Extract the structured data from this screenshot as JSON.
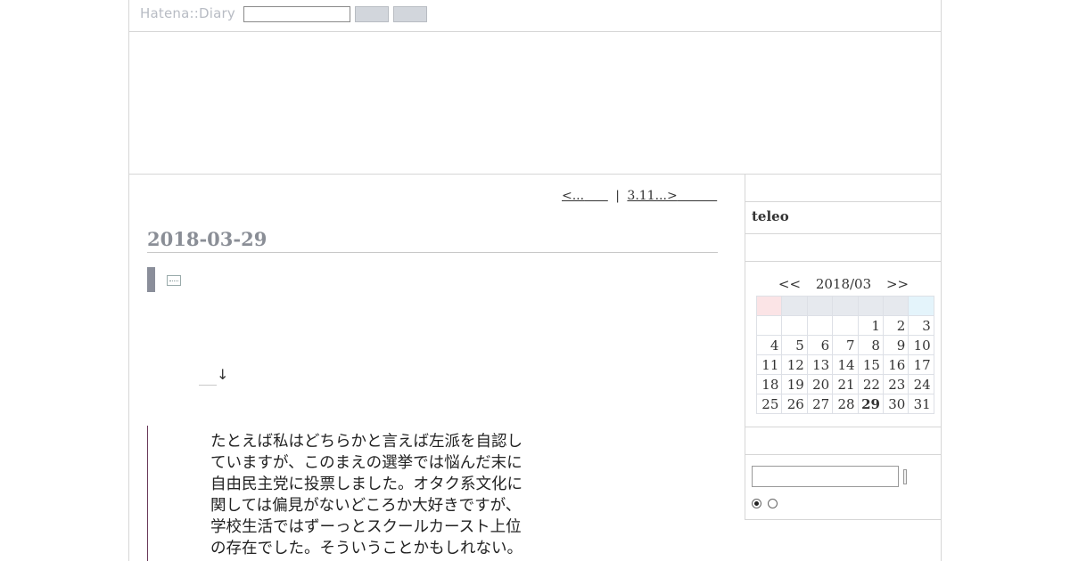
{
  "header": {
    "logo": "Hatena::Diary"
  },
  "nav": {
    "prev": "<...",
    "separator": "|",
    "next": "3.11...>"
  },
  "entry": {
    "date": "2018-03-29",
    "arrow": "↓",
    "quote": "たとえば私はどちらかと言えば左派を自認していますが、このまえの選挙では悩んだ末に自由民主党に投票しました。オタク系文化に関しては偏見がないどころか大好きですが、学校生活ではずーっとスクールカースト上位の存在でした。そういうことかもしれない。彼はそれなり"
  },
  "sidebar": {
    "title": "teleo",
    "calendar": {
      "prev": "<<",
      "month": "2018/03",
      "next": ">>",
      "weeks": [
        [
          "",
          "",
          "",
          "",
          "1",
          "2",
          "3"
        ],
        [
          "4",
          "5",
          "6",
          "7",
          "8",
          "9",
          "10"
        ],
        [
          "11",
          "12",
          "13",
          "14",
          "15",
          "16",
          "17"
        ],
        [
          "18",
          "19",
          "20",
          "21",
          "22",
          "23",
          "24"
        ],
        [
          "25",
          "26",
          "27",
          "28",
          "29",
          "30",
          "31"
        ]
      ],
      "highlighted_day": "29"
    }
  }
}
